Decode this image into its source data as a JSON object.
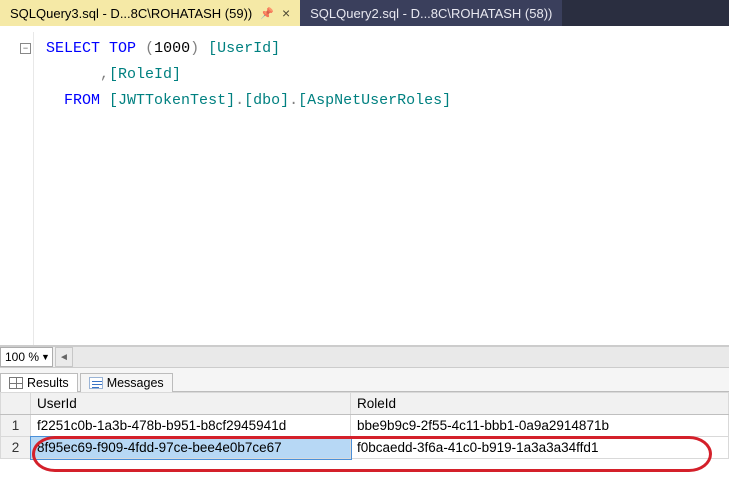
{
  "tabs": {
    "active": {
      "label": "SQLQuery3.sql - D...8C\\ROHATASH (59))"
    },
    "inactive": {
      "label": "SQLQuery2.sql - D...8C\\ROHATASH (58))"
    }
  },
  "sql": {
    "select": "SELECT",
    "top": "TOP",
    "topn_open": "(",
    "topn": "1000",
    "topn_close": ")",
    "col1": "[UserId]",
    "comma": ",",
    "col2": "[RoleId]",
    "from": "FROM",
    "db": "[JWTTokenTest]",
    "dot": ".",
    "schema": "[dbo]",
    "table": "[AspNetUserRoles]"
  },
  "zoom": {
    "value": "100 %"
  },
  "result_tabs": {
    "results": "Results",
    "messages": "Messages"
  },
  "grid": {
    "headers": {
      "user": "UserId",
      "role": "RoleId"
    },
    "rows": [
      {
        "n": "1",
        "user": "f2251c0b-1a3b-478b-b951-b8cf2945941d",
        "role": "bbe9b9c9-2f55-4c11-bbb1-0a9a2914871b"
      },
      {
        "n": "2",
        "user": "8f95ec69-f909-4fdd-97ce-bee4e0b7ce67",
        "role": "f0bcaedd-3f6a-41c0-b919-1a3a3a34ffd1"
      }
    ]
  }
}
